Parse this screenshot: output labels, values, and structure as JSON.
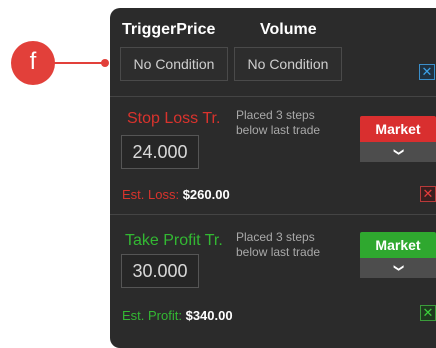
{
  "callout": {
    "letter": "f"
  },
  "header": {
    "trigger_price": "TriggerPrice",
    "volume": "Volume"
  },
  "conditions": {
    "trigger_price": "No Condition",
    "volume": "No Condition"
  },
  "stop_loss": {
    "label": "Stop Loss Tr.",
    "note": "Placed 3 steps below last trade",
    "value": "24.000",
    "button": "Market",
    "est_label": "Est. Loss:",
    "est_value": "$260.00"
  },
  "take_profit": {
    "label": "Take Profit Tr.",
    "note": "Placed 3 steps below last trade",
    "value": "30.000",
    "button": "Market",
    "est_label": "Est. Profit:",
    "est_value": "$340.00"
  },
  "icons": {
    "checkbox": "x-mark-icon",
    "dropdown": "chevron-down-icon"
  },
  "colors": {
    "callout": "#e2403a",
    "panel": "#2b2b2b",
    "loss": "#d92f2f",
    "profit": "#2fa82f",
    "accent": "#3ba1e8"
  }
}
